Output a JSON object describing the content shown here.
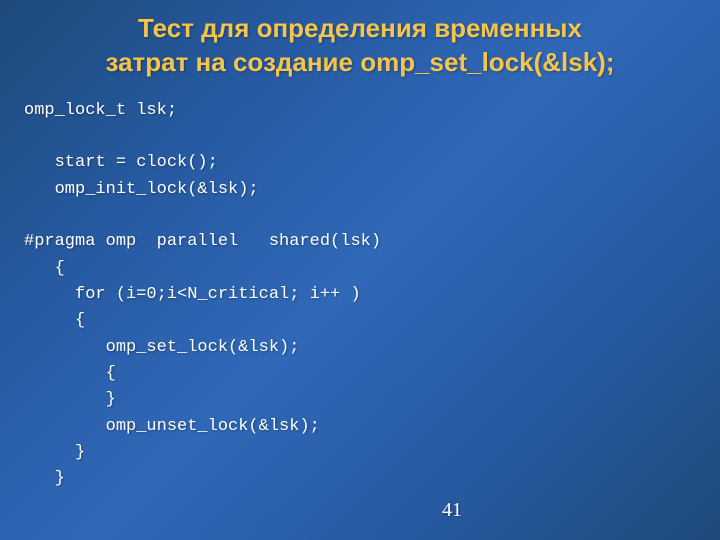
{
  "title_line1": "Тест для определения временных",
  "title_line2": "затрат на создание omp_set_lock(&lsk);",
  "code": {
    "l1": "omp_lock_t lsk;",
    "l2": "",
    "l3": "   start = clock();",
    "l4": "   omp_init_lock(&lsk);",
    "l5": "",
    "l6": "#pragma omp  parallel   shared(lsk)",
    "l7": "   {",
    "l8": "     for (i=0;i<N_critical; i++ )",
    "l9": "     {",
    "l10": "        omp_set_lock(&lsk);",
    "l11": "        {",
    "l12": "        }",
    "l13": "        omp_unset_lock(&lsk);",
    "l14": "     }",
    "l15": "   }"
  },
  "page_number": "41"
}
